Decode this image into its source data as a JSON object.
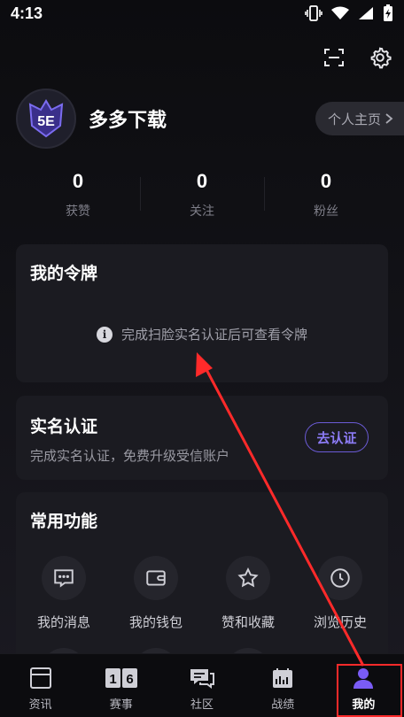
{
  "status_bar": {
    "time": "4:13"
  },
  "profile": {
    "username": "多多下载",
    "homepage_label": "个人主页",
    "avatar_text": "5E"
  },
  "stats": [
    {
      "value": "0",
      "label": "获赞"
    },
    {
      "value": "0",
      "label": "关注"
    },
    {
      "value": "0",
      "label": "粉丝"
    }
  ],
  "token_card": {
    "title": "我的令牌",
    "info": "完成扫脸实名认证后可查看令牌"
  },
  "realname_card": {
    "title": "实名认证",
    "subtitle": "完成实名认证，免费升级受信账户",
    "button": "去认证"
  },
  "functions_card": {
    "title": "常用功能",
    "items": [
      {
        "label": "我的消息",
        "icon": "message-icon"
      },
      {
        "label": "我的钱包",
        "icon": "wallet-icon"
      },
      {
        "label": "赞和收藏",
        "icon": "star-icon"
      },
      {
        "label": "浏览历史",
        "icon": "clock-icon"
      }
    ]
  },
  "tabbar": {
    "tabs": [
      {
        "label": "资讯",
        "icon": "news-icon",
        "active": false
      },
      {
        "label": "赛事",
        "icon": "match-icon",
        "active": false,
        "icon_text": "16"
      },
      {
        "label": "社区",
        "icon": "community-icon",
        "active": false
      },
      {
        "label": "战绩",
        "icon": "record-icon",
        "active": false
      },
      {
        "label": "我的",
        "icon": "profile-icon",
        "active": true
      }
    ]
  },
  "colors": {
    "accent": "#6b5bd6",
    "highlight": "#ff2a2a",
    "background": "#0c0c0f",
    "card": "#1b1b21"
  }
}
